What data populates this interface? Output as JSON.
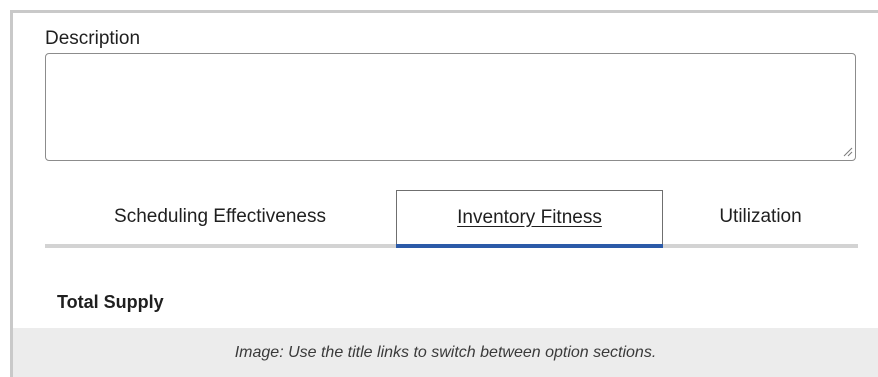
{
  "form": {
    "description_label": "Description",
    "description_value": "",
    "description_placeholder": ""
  },
  "tabs": [
    {
      "label": "Scheduling Effectiveness",
      "active": false
    },
    {
      "label": "Inventory Fitness",
      "active": true
    },
    {
      "label": "Utilization",
      "active": false
    }
  ],
  "section": {
    "title": "Total Supply"
  },
  "caption": {
    "text": "Image: Use the title links to switch between option sections."
  },
  "colors": {
    "active_tab_indicator": "#2b5aa8",
    "tab_rail": "#d3d3d3",
    "caption_background": "#ececec"
  },
  "icons": {
    "textarea_resize": "resize-grip-icon"
  }
}
